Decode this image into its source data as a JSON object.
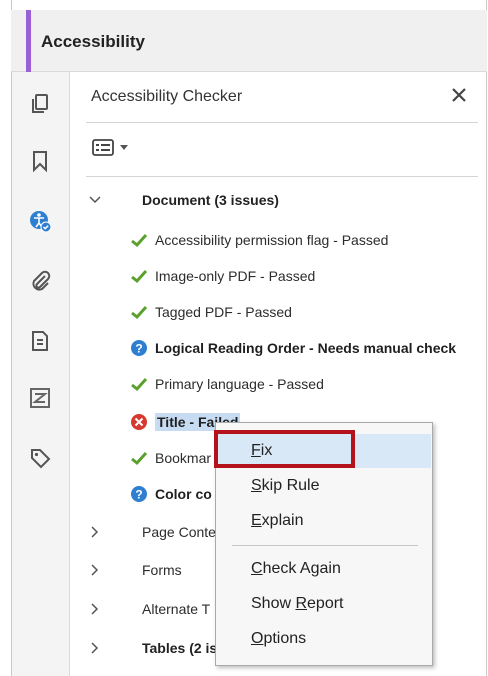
{
  "header": {
    "title": "Accessibility"
  },
  "rail": {
    "icons": [
      "pages-icon",
      "bookmark-icon",
      "accessibility-icon",
      "attachment-icon",
      "document-icon",
      "content-icon",
      "tag-icon"
    ]
  },
  "panel": {
    "title": "Accessibility Checker",
    "close_glyph": "✕"
  },
  "tree": {
    "document_group": "Document (3 issues)",
    "items": [
      {
        "text": "Accessibility permission flag - Passed",
        "status": "passed",
        "bold": false
      },
      {
        "text": "Image-only PDF - Passed",
        "status": "passed",
        "bold": false
      },
      {
        "text": "Tagged PDF - Passed",
        "status": "passed",
        "bold": false
      },
      {
        "text": "Logical Reading Order - Needs manual check",
        "status": "manual",
        "bold": true
      },
      {
        "text": "Primary language - Passed",
        "status": "passed",
        "bold": false
      },
      {
        "text": "Title - Failed",
        "status": "failed",
        "bold": true
      },
      {
        "text": "Bookmar",
        "status": "passed",
        "bold": false
      },
      {
        "text": "Color co",
        "status": "manual",
        "bold": true
      }
    ],
    "groups": [
      {
        "text": "Page Conte",
        "bold": false
      },
      {
        "text": "Forms",
        "bold": false
      },
      {
        "text": "Alternate T",
        "bold": false
      },
      {
        "text": "Tables (2 is",
        "bold": true
      }
    ]
  },
  "context_menu": {
    "fix": {
      "first": "F",
      "rest": "ix"
    },
    "skip_rule": {
      "first": "S",
      "rest": "kip Rule"
    },
    "explain": {
      "first": "E",
      "rest": "xplain"
    },
    "check_again": {
      "first": "C",
      "rest": "heck Again"
    },
    "show_report": {
      "pre": "Show ",
      "first": "R",
      "rest": "eport"
    },
    "options": {
      "first": "O",
      "rest": "ptions"
    }
  },
  "colors": {
    "accent": "#9b5fd6",
    "highlight": "#b3121b",
    "passed": "#5aa02c",
    "manual": "#2f7fd1",
    "failed": "#d8392f"
  }
}
